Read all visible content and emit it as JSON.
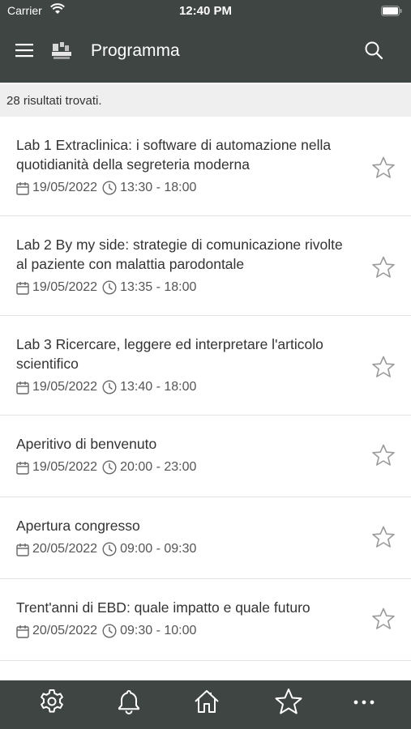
{
  "status_bar": {
    "carrier": "Carrier",
    "time": "12:40 PM"
  },
  "header": {
    "title": "Programma",
    "menu_icon": "menu-icon",
    "logo_icon": "app-logo",
    "search_icon": "search-icon"
  },
  "results": {
    "text": "28 risultati trovati."
  },
  "items": [
    {
      "title": "Lab 1 Extraclinica: i software di automazione nella quotidianità della segreteria moderna",
      "date": "19/05/2022",
      "time": "13:30 - 18:00"
    },
    {
      "title": "Lab 2 By my side: strategie di comunicazione rivolte al paziente con malattia parodontale",
      "date": "19/05/2022",
      "time": "13:35 - 18:00"
    },
    {
      "title": "Lab 3 Ricercare, leggere ed interpretare l'articolo scientifico",
      "date": "19/05/2022",
      "time": "13:40 - 18:00"
    },
    {
      "title": "Aperitivo di benvenuto",
      "date": "19/05/2022",
      "time": "20:00 - 23:00"
    },
    {
      "title": "Apertura congresso",
      "date": "20/05/2022",
      "time": "09:00 - 09:30"
    },
    {
      "title": "Trent'anni di EBD: quale impatto e quale futuro",
      "date": "20/05/2022",
      "time": "09:30 - 10:00"
    }
  ],
  "tab_bar": {
    "icons": [
      "settings-icon",
      "bell-icon",
      "home-icon",
      "star-icon",
      "more-icon"
    ]
  },
  "colors": {
    "header_bg": "#3e4542",
    "results_bg": "#efefef",
    "star_outline": "#9a9a9a"
  }
}
